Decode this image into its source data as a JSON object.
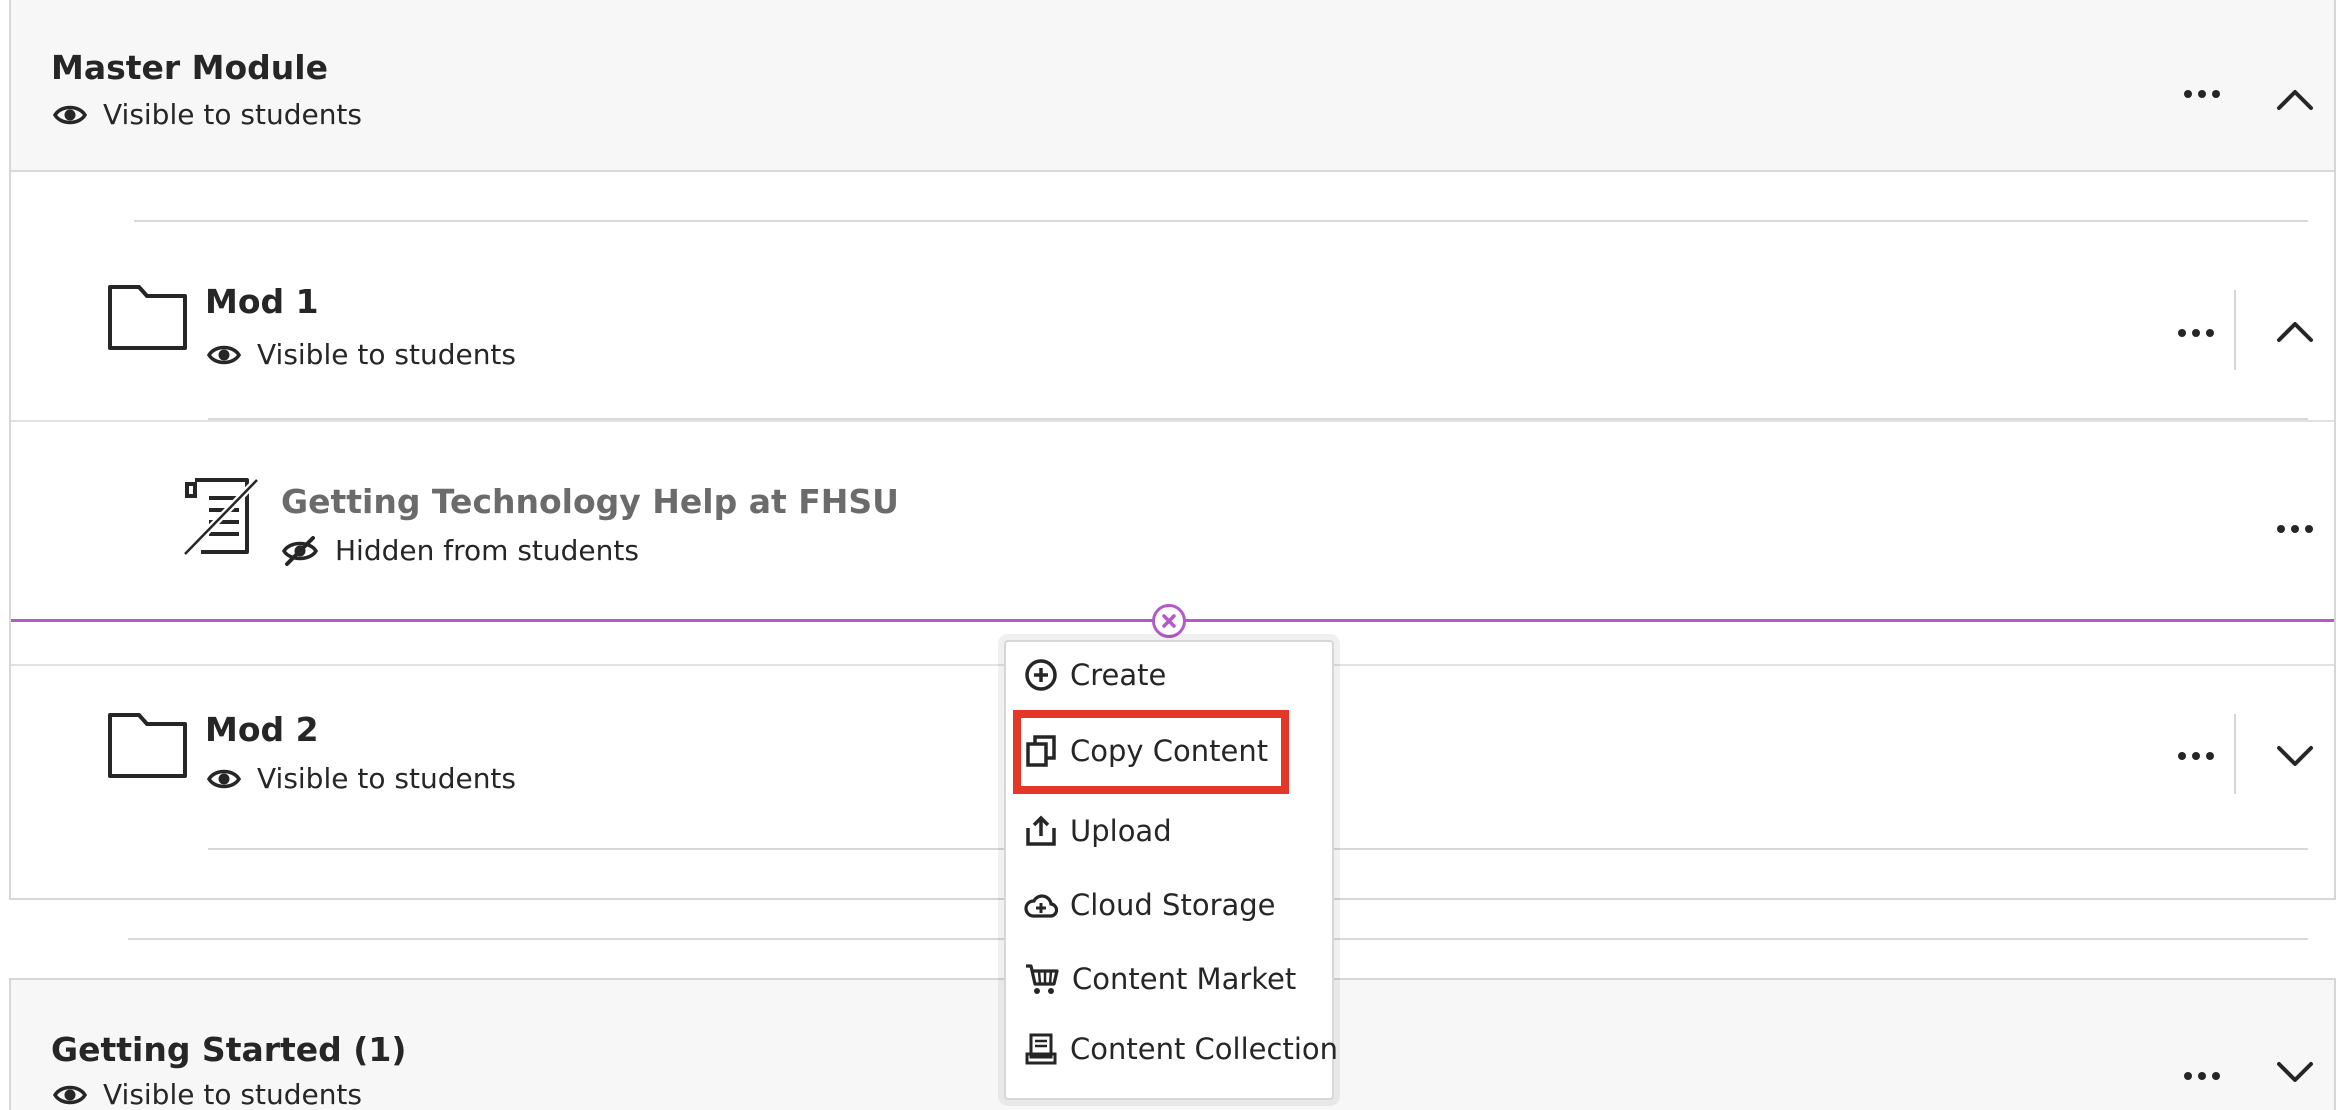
{
  "colors": {
    "accent_purple": "#b35ac8",
    "highlight_red": "#e3372a",
    "folder_bg": "#f7f7f7",
    "border_gray": "#d6d6d6"
  },
  "modules": {
    "master": {
      "title": "Master Module",
      "status": "Visible to students",
      "status_icon": "eye-icon",
      "expanded": true
    },
    "mod1": {
      "title": "Mod 1",
      "status": "Visible to students",
      "status_icon": "eye-icon",
      "expanded": true,
      "items": [
        {
          "title": "Getting Technology Help at FHSU",
          "status": "Hidden from students",
          "status_icon": "eye-slash-icon"
        }
      ]
    },
    "mod2": {
      "title": "Mod 2",
      "status": "Visible to students",
      "status_icon": "eye-icon",
      "expanded": false
    },
    "getting_started": {
      "title": "Getting Started (1)",
      "status": "Visible to students",
      "status_icon": "eye-icon",
      "expanded": false
    }
  },
  "insert_menu": {
    "items": [
      {
        "label": "Create",
        "icon": "plus-circle-icon"
      },
      {
        "label": "Copy Content",
        "icon": "copy-icon",
        "highlighted": true
      },
      {
        "label": "Upload",
        "icon": "upload-icon"
      },
      {
        "label": "Cloud Storage",
        "icon": "cloud-icon"
      },
      {
        "label": "Content Market",
        "icon": "cart-icon"
      },
      {
        "label": "Content Collection",
        "icon": "collection-icon"
      }
    ]
  }
}
